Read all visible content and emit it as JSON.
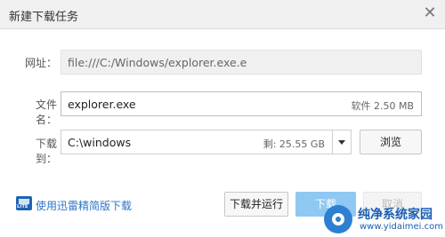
{
  "window": {
    "title": "新建下载任务",
    "close_symbol": "✕"
  },
  "form": {
    "url": {
      "label": "网址：",
      "value": "file:///C:/Windows/explorer.exe.e"
    },
    "filename": {
      "label": "文件名：",
      "value": "explorer.exe",
      "file_type": "软件",
      "file_size": "2.50 MB"
    },
    "download_to": {
      "label": "下载到：",
      "path": "C:\\windows",
      "free_space": "剩: 25.55 GB"
    }
  },
  "buttons": {
    "browse": "浏览",
    "download_and_run": "下载并运行",
    "download": "下载",
    "cancel": "取消"
  },
  "footer": {
    "lite_icon_text": "LITE",
    "lite_link": "使用迅雷精简版下载"
  },
  "watermark": {
    "brand": "纯净系统家园",
    "url": "www.yidaimei.com"
  },
  "colors": {
    "link": "#2f74c7",
    "primary": "#8fc8f2",
    "watermark": "#1a5fb3"
  }
}
